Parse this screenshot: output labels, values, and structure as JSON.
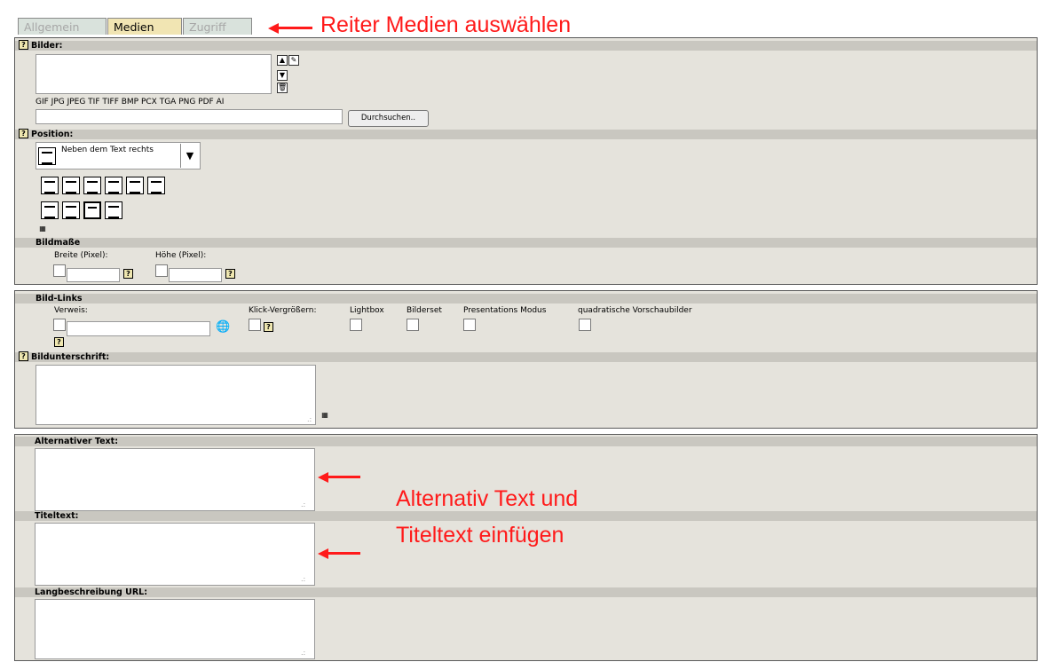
{
  "tabs": [
    {
      "label": "Allgemein",
      "active": false
    },
    {
      "label": "Medien",
      "active": true
    },
    {
      "label": "Zugriff",
      "active": false
    }
  ],
  "annotations": {
    "tab_hint": "Reiter Medien auswählen",
    "alt_hint_line1": "Alternativ Text und",
    "alt_hint_line2": "Titeltext einfügen"
  },
  "help_label": "?",
  "images": {
    "label": "Bilder:",
    "formats": "GIF JPG JPEG TIF TIFF BMP PCX TGA PNG PDF AI",
    "file_input_value": "",
    "browse_label": "Durchsuchen.."
  },
  "position": {
    "label": "Position:",
    "selected": "Neben dem Text rechts"
  },
  "dimensions": {
    "label": "Bildmaße",
    "width_label": "Breite (Pixel):",
    "height_label": "Höhe (Pixel):",
    "width_value": "",
    "height_value": ""
  },
  "links": {
    "label": "Bild-Links",
    "reference_label": "Verweis:",
    "reference_value": "",
    "click_enlarge_label": "Klick-Vergrößern:",
    "lightbox_label": "Lightbox",
    "imageset_label": "Bilderset",
    "presentation_label": "Presentations Modus",
    "square_thumbs_label": "quadratische Vorschaubilder"
  },
  "caption": {
    "label": "Bildunterschrift:",
    "value": ""
  },
  "alt_text": {
    "label": "Alternativer Text:",
    "value": ""
  },
  "title_text": {
    "label": "Titeltext:",
    "value": ""
  },
  "long_desc": {
    "label": "Langbeschreibung URL:",
    "value": ""
  },
  "colors": {
    "panel_bg": "#e5e3dc",
    "header_bar": "#c9c7c0",
    "active_tab": "#f1e5b3",
    "inactive_tab": "#d9e2dc",
    "annotation_red": "#ff1a1a"
  }
}
